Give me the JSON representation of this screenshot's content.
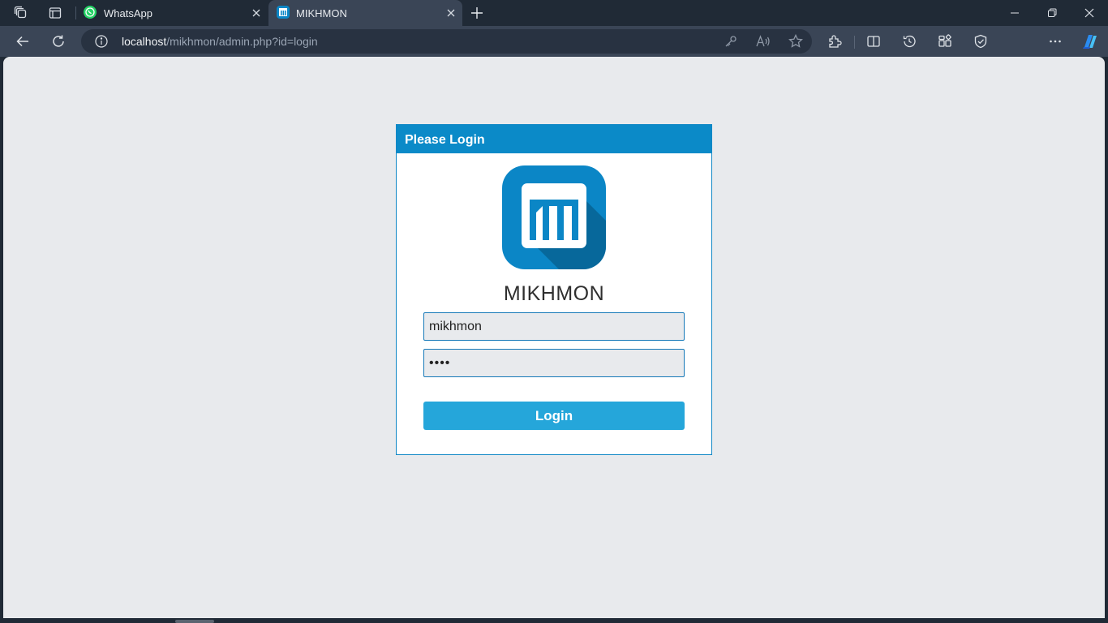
{
  "browser": {
    "tabs": [
      {
        "title": "WhatsApp",
        "icon": "whatsapp-icon",
        "active": false
      },
      {
        "title": "MIKHMON",
        "icon": "mikhmon-favicon-icon",
        "active": true
      }
    ],
    "address": {
      "host": "localhost",
      "path": "/mikhmon/admin.php?id=login"
    },
    "colors": {
      "chrome_bg": "#202a36",
      "toolbar_bg": "#3a4556",
      "page_bg": "#e8eaed"
    }
  },
  "login": {
    "header": "Please Login",
    "app_name": "MIKHMON",
    "username_value": "mikhmon",
    "password_value": "1234",
    "button_label": "Login",
    "colors": {
      "header_bg": "#0b8ac8",
      "button_bg": "#25a6da",
      "logo_bg": "#0b86c6"
    }
  }
}
